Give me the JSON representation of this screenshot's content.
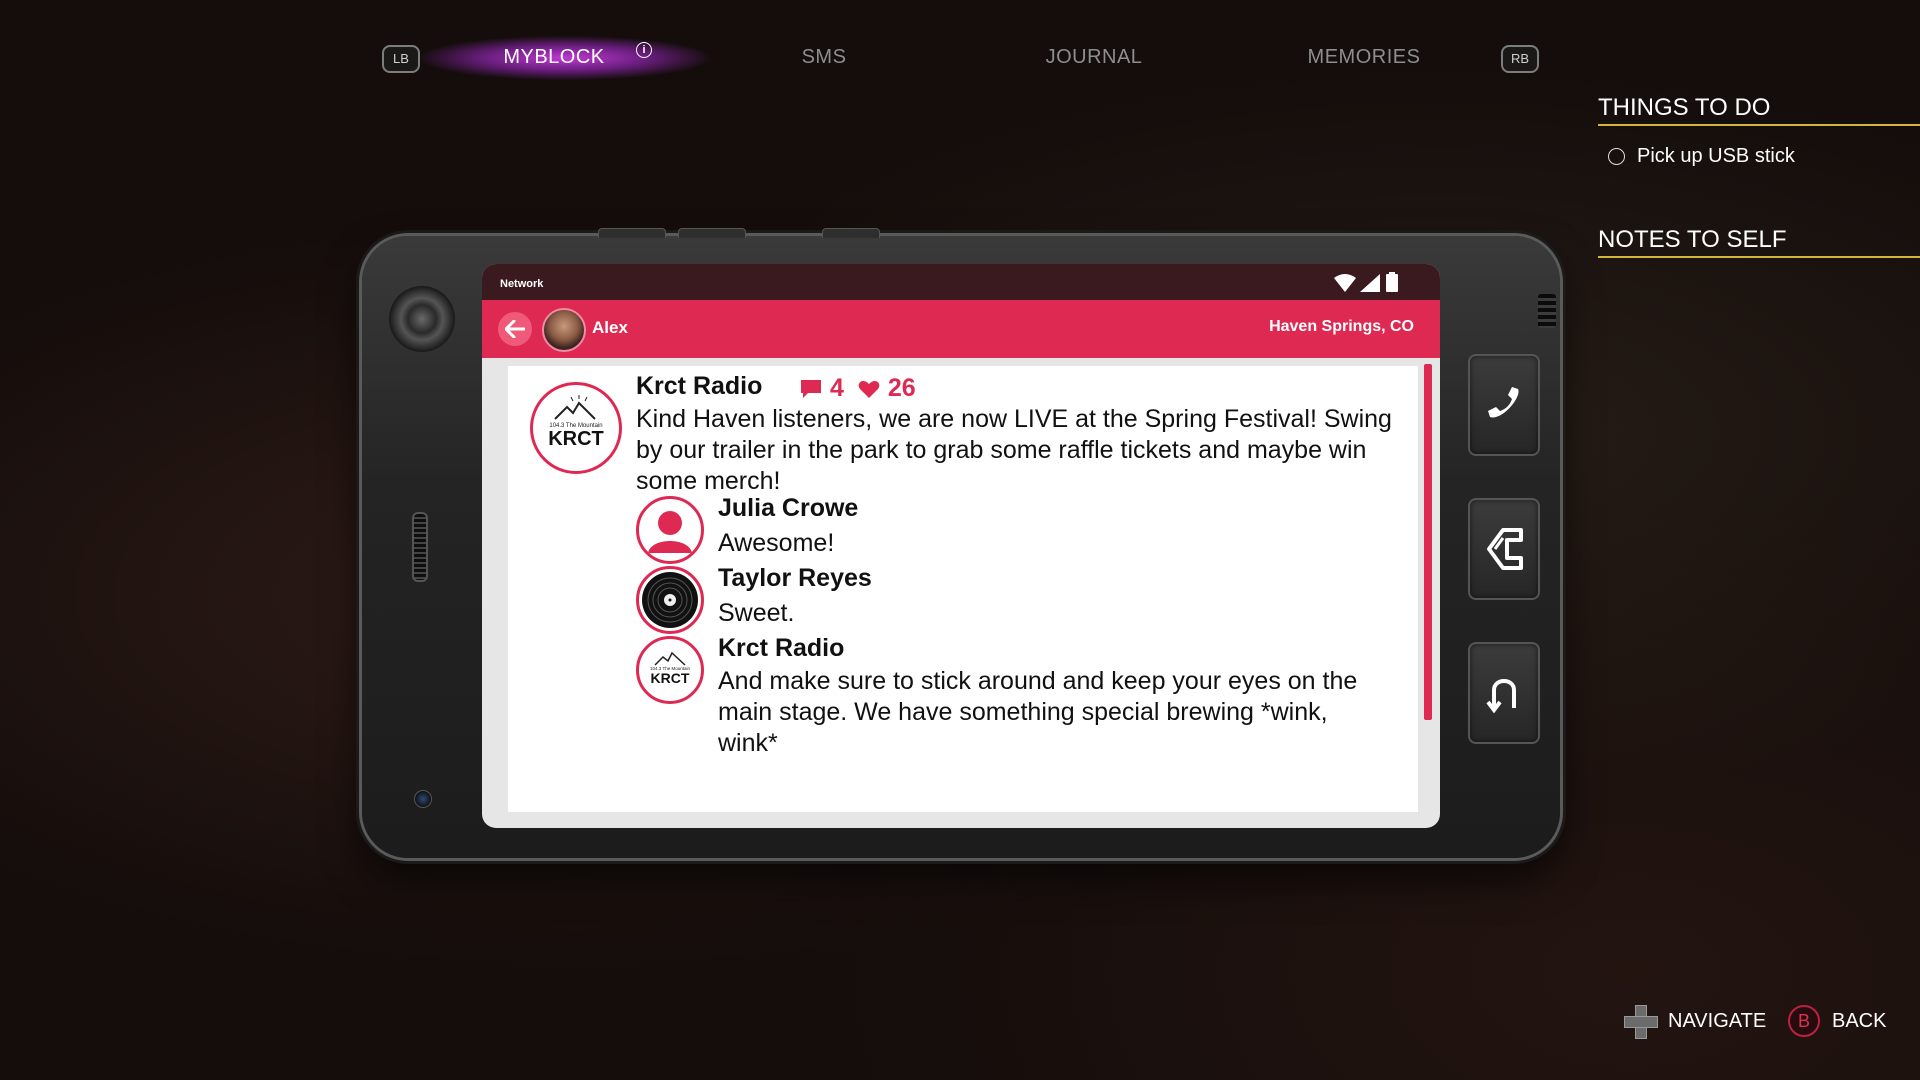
{
  "nav": {
    "lb": "LB",
    "rb": "RB",
    "tabs": [
      {
        "label": "MYBLOCK",
        "active": true
      },
      {
        "label": "SMS",
        "active": false
      },
      {
        "label": "JOURNAL",
        "active": false
      },
      {
        "label": "MEMORIES",
        "active": false
      }
    ]
  },
  "side_panel": {
    "todo_heading": "THINGS TO DO",
    "todo_items": [
      "Pick up USB stick"
    ],
    "notes_heading": "NOTES TO SELF"
  },
  "phone": {
    "status_label": "Network",
    "app_user": "Alex",
    "app_location": "Haven Springs, CO",
    "accent_color": "#de2a53",
    "post": {
      "author": "Krct Radio",
      "avatar_text_small": "104.3 The Mountain",
      "avatar_text_big": "KRCT",
      "comment_count": "4",
      "like_count": "26",
      "text": "Kind Haven listeners, we are now LIVE at the Spring Festival! Swing by our trailer in the park to grab some raffle tickets and maybe win some merch!"
    },
    "comments": [
      {
        "author": "Julia Crowe",
        "text": "Awesome!",
        "avatar": "person-icon"
      },
      {
        "author": "Taylor Reyes",
        "text": "Sweet.",
        "avatar": "vinyl-record-icon"
      },
      {
        "author": "Krct Radio",
        "text": "And make sure to stick around and keep your eyes on the main stage. We have something special brewing *wink, wink*",
        "avatar": "krct-logo"
      }
    ]
  },
  "hints": {
    "navigate": "NAVIGATE",
    "back_button": "B",
    "back": "BACK"
  }
}
